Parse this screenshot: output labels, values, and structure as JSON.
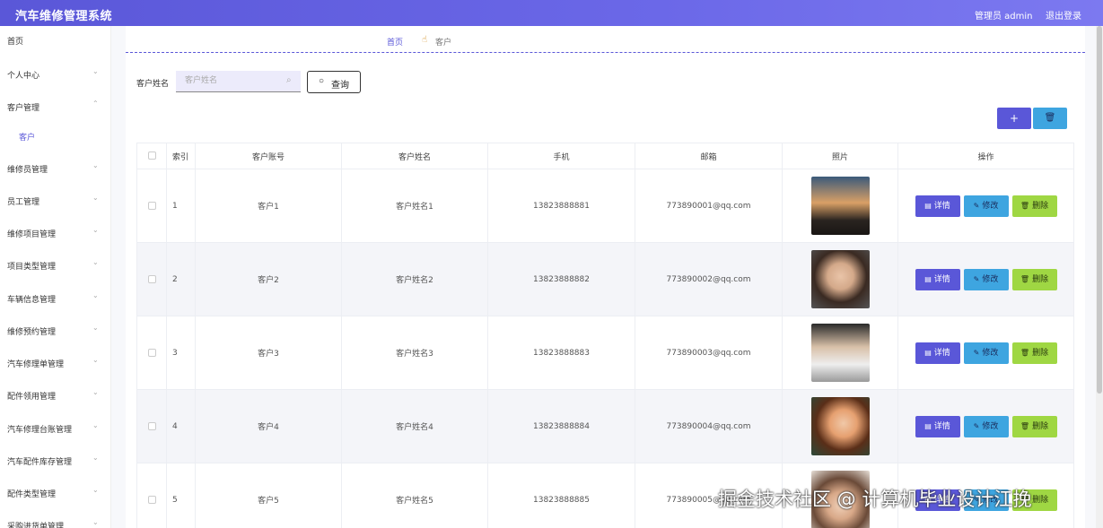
{
  "header": {
    "title": "汽车维修管理系统",
    "user": "管理员 admin",
    "logout": "退出登录"
  },
  "sidebar": {
    "items": [
      {
        "label": "首页",
        "has_children": false
      },
      {
        "label": "个人中心",
        "has_children": true
      },
      {
        "label": "客户管理",
        "has_children": true
      },
      {
        "label": "客户",
        "has_children": false,
        "sub": true
      },
      {
        "label": "维修员管理",
        "has_children": true
      },
      {
        "label": "员工管理",
        "has_children": true
      },
      {
        "label": "维修项目管理",
        "has_children": true
      },
      {
        "label": "项目类型管理",
        "has_children": true
      },
      {
        "label": "车辆信息管理",
        "has_children": true
      },
      {
        "label": "维修预约管理",
        "has_children": true
      },
      {
        "label": "汽车修理单管理",
        "has_children": true
      },
      {
        "label": "配件领用管理",
        "has_children": true
      },
      {
        "label": "汽车修理台账管理",
        "has_children": true
      },
      {
        "label": "汽车配件库存管理",
        "has_children": true
      },
      {
        "label": "配件类型管理",
        "has_children": true
      },
      {
        "label": "采购进货单管理",
        "has_children": true
      }
    ]
  },
  "breadcrumb": {
    "home": "首页",
    "current": "客户"
  },
  "search": {
    "label": "客户姓名",
    "placeholder": "客户姓名",
    "button": "查询"
  },
  "toolbar": {
    "add": "+",
    "delete": "🗑"
  },
  "table": {
    "headers": [
      "索引",
      "客户账号",
      "客户姓名",
      "手机",
      "邮箱",
      "照片",
      "操作"
    ],
    "rows": [
      {
        "index": "1",
        "account": "客户1",
        "name": "客户姓名1",
        "phone": "13823888881",
        "email": "773890001@qq.com"
      },
      {
        "index": "2",
        "account": "客户2",
        "name": "客户姓名2",
        "phone": "13823888882",
        "email": "773890002@qq.com"
      },
      {
        "index": "3",
        "account": "客户3",
        "name": "客户姓名3",
        "phone": "13823888883",
        "email": "773890003@qq.com"
      },
      {
        "index": "4",
        "account": "客户4",
        "name": "客户姓名4",
        "phone": "13823888884",
        "email": "773890004@qq.com"
      },
      {
        "index": "5",
        "account": "客户5",
        "name": "客户姓名5",
        "phone": "13823888885",
        "email": "773890005@qq.com"
      }
    ],
    "ops": {
      "detail": "详情",
      "edit": "修改",
      "delete": "删除"
    }
  },
  "watermark": "掘金技术社区 @ 计算机毕业设计江挽",
  "colors": {
    "primary": "#5a57d8",
    "edit": "#3ea5e0",
    "delete": "#9fd743"
  }
}
